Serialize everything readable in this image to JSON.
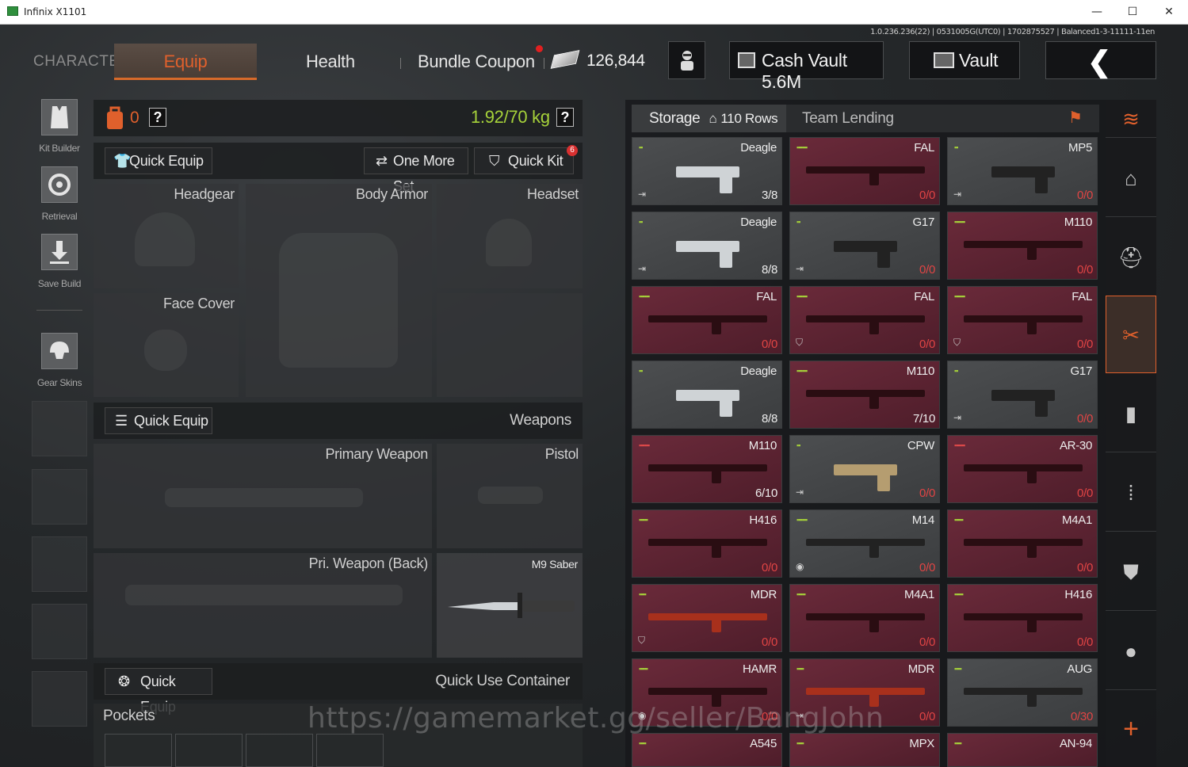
{
  "window": {
    "title": "Infinix X1101",
    "minimize": "—",
    "maximize": "☐",
    "close": "✕"
  },
  "version_text": "1.0.236.236(22) | 0531005G(UTC0) | 1702875527 | Balanced1-3-11111-11en",
  "nav": {
    "character": "CHARACTER",
    "equip": "Equip",
    "health": "Health",
    "bundle_coupon": "Bundle Coupon",
    "currency_amount": "126,844",
    "cash_vault": "Cash Vault 5.6M",
    "vault": "Vault",
    "back": "❮"
  },
  "sidebar": {
    "kit_builder": "Kit Builder",
    "retrieval": "Retrieval",
    "save_build": "Save Build",
    "gear_skins": "Gear Skins"
  },
  "loadout": {
    "backpack_count": "0",
    "help": "?",
    "weight": "1.92/70 kg",
    "quick_equip": "Quick Equip",
    "one_more_set": "One More Set",
    "quick_kit": "Quick Kit",
    "quick_kit_badge": "6",
    "slots": {
      "headgear": "Headgear",
      "body_armor": "Body Armor",
      "headset": "Headset",
      "face_cover": "Face Cover"
    },
    "weapons_section": "Weapons",
    "weapons_quick_equip": "Quick Equip",
    "primary_weapon": "Primary Weapon",
    "pistol": "Pistol",
    "pri_weapon_back": "Pri. Weapon (Back)",
    "melee": "M9 Saber",
    "quick_use_quick_equip": "Quick Equip",
    "quick_use_container": "Quick Use Container",
    "pockets": "Pockets"
  },
  "storage": {
    "tab_storage": "Storage",
    "rows": "110 Rows",
    "tab_team_lending": "Team Lending",
    "items": [
      {
        "name": "Deagle",
        "count": "3/8",
        "color": "gray",
        "dots": "▪▪",
        "dotcolor": "green",
        "badge": "⇥"
      },
      {
        "name": "FAL",
        "count": "0/0",
        "color": "red",
        "dots": "▪▪▪▪▪▪",
        "dotcolor": "green",
        "badge": ""
      },
      {
        "name": "MP5",
        "count": "0/0",
        "color": "gray",
        "dots": "▪▪",
        "dotcolor": "green",
        "badge": "⇥"
      },
      {
        "name": "Deagle",
        "count": "8/8",
        "color": "gray",
        "dots": "▪▪",
        "dotcolor": "green",
        "badge": "⇥"
      },
      {
        "name": "G17",
        "count": "0/0",
        "color": "gray",
        "dots": "▪▪",
        "dotcolor": "green",
        "badge": "⇥"
      },
      {
        "name": "M110",
        "count": "0/0",
        "color": "red",
        "dots": "▪▪▪▪▪▪",
        "dotcolor": "green",
        "badge": ""
      },
      {
        "name": "FAL",
        "count": "0/0",
        "color": "red",
        "dots": "▪▪▪▪▪▪",
        "dotcolor": "green",
        "badge": ""
      },
      {
        "name": "FAL",
        "count": "0/0",
        "color": "red",
        "dots": "▪▪▪▪▪▪",
        "dotcolor": "green",
        "badge": "⛉"
      },
      {
        "name": "FAL",
        "count": "0/0",
        "color": "red",
        "dots": "▪▪▪▪▪▪",
        "dotcolor": "green",
        "badge": "⛉"
      },
      {
        "name": "Deagle",
        "count": "8/8",
        "color": "gray",
        "dots": "▪▪",
        "dotcolor": "green",
        "badge": ""
      },
      {
        "name": "M110",
        "count": "7/10",
        "color": "red",
        "dots": "▪▪▪▪▪▪",
        "dotcolor": "green",
        "badge": ""
      },
      {
        "name": "G17",
        "count": "0/0",
        "color": "gray",
        "dots": "▪▪",
        "dotcolor": "green",
        "badge": "⇥"
      },
      {
        "name": "M110",
        "count": "6/10",
        "color": "red",
        "dots": "▪▪▪▪▪▪",
        "dotcolor": "red",
        "badge": ""
      },
      {
        "name": "CPW",
        "count": "0/0",
        "color": "gray",
        "dots": "▪▪",
        "dotcolor": "green",
        "badge": "⇥"
      },
      {
        "name": "AR-30",
        "count": "0/0",
        "color": "red",
        "dots": "▪▪▪▪▪▪",
        "dotcolor": "red",
        "badge": ""
      },
      {
        "name": "H416",
        "count": "0/0",
        "color": "red",
        "dots": "▪▪▪▪▪",
        "dotcolor": "green",
        "badge": ""
      },
      {
        "name": "M14",
        "count": "0/0",
        "color": "gray",
        "dots": "▪▪▪▪▪▪",
        "dotcolor": "green",
        "badge": "◉"
      },
      {
        "name": "M4A1",
        "count": "0/0",
        "color": "red",
        "dots": "▪▪▪▪▪",
        "dotcolor": "green",
        "badge": ""
      },
      {
        "name": "MDR",
        "count": "0/0",
        "color": "red",
        "dots": "▪▪▪▪",
        "dotcolor": "green",
        "badge": "⛉"
      },
      {
        "name": "M4A1",
        "count": "0/0",
        "color": "red",
        "dots": "▪▪▪▪▪",
        "dotcolor": "green",
        "badge": ""
      },
      {
        "name": "H416",
        "count": "0/0",
        "color": "red",
        "dots": "▪▪▪▪▪",
        "dotcolor": "green",
        "badge": ""
      },
      {
        "name": "HAMR",
        "count": "0/0",
        "color": "red",
        "dots": "▪▪▪▪▪",
        "dotcolor": "green",
        "badge": "◉"
      },
      {
        "name": "MDR",
        "count": "0/0",
        "color": "red",
        "dots": "▪▪▪▪",
        "dotcolor": "green",
        "badge": "⇥"
      },
      {
        "name": "AUG",
        "count": "0/30",
        "color": "gray",
        "dots": "▪▪▪▪",
        "dotcolor": "green",
        "badge": ""
      },
      {
        "name": "A545",
        "count": "",
        "color": "red",
        "dots": "▪▪▪▪",
        "dotcolor": "green",
        "badge": ""
      },
      {
        "name": "MPX",
        "count": "",
        "color": "red",
        "dots": "▪▪▪▪",
        "dotcolor": "green",
        "badge": ""
      },
      {
        "name": "AN-94",
        "count": "",
        "color": "red",
        "dots": "▪▪▪▪",
        "dotcolor": "green",
        "badge": ""
      }
    ]
  },
  "right_column": {
    "icons": [
      "stack-icon",
      "home-icon",
      "helmet-icon",
      "rifle-icon",
      "magazine-icon",
      "ammo-icon",
      "vest-icon",
      "grenade-icon",
      "add-icon"
    ]
  },
  "watermark": "https://gamemarket.gg/seller/BangJohn",
  "colors": {
    "accent": "#e0602c",
    "weight": "#a6d23a",
    "zero_count": "#e04444"
  }
}
